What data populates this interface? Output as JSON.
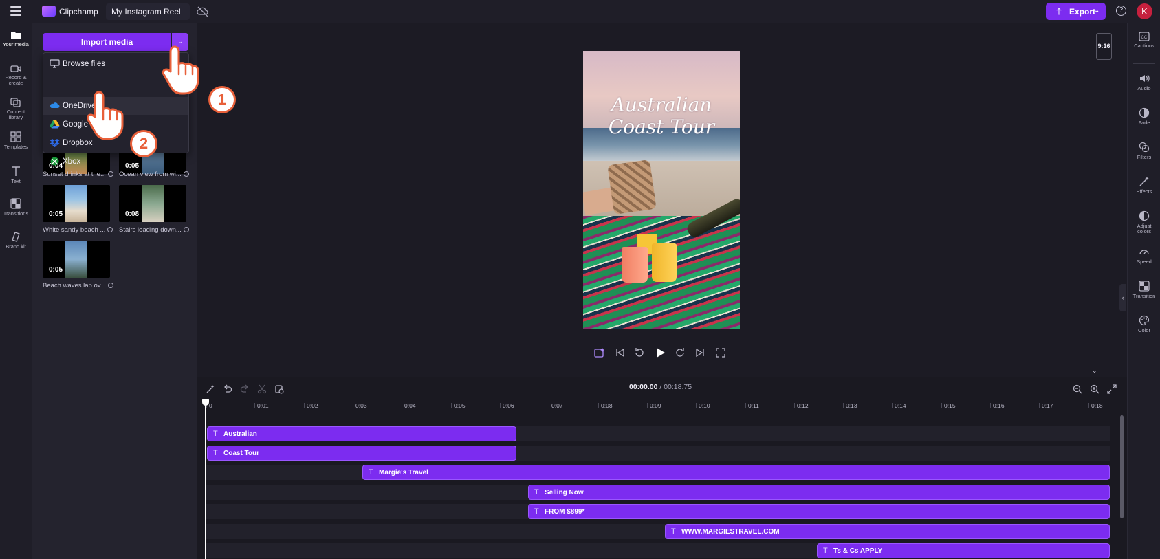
{
  "topbar": {
    "app_name": "Clipchamp",
    "project_name": "My Instagram Reel",
    "export_label": "Export",
    "help_label": "?",
    "avatar_initial": "K"
  },
  "left_rail": {
    "items": [
      {
        "label": "Your media"
      },
      {
        "label": "Record &"
      },
      {
        "label": "create"
      },
      {
        "label": "Content"
      },
      {
        "label": "library"
      },
      {
        "label": "Templates"
      },
      {
        "label": "Text"
      },
      {
        "label": "Transitions"
      },
      {
        "label": "Brand kit"
      }
    ]
  },
  "media_panel": {
    "import_label": "Import media",
    "dropdown": {
      "items": [
        {
          "label": "Browse files",
          "icon": "monitor-icon"
        },
        {
          "label": "OneDrive",
          "icon": "onedrive-icon"
        },
        {
          "label": "Google Drive",
          "icon": "google-drive-icon"
        },
        {
          "label": "Dropbox",
          "icon": "dropbox-icon"
        },
        {
          "label": "Xbox",
          "icon": "xbox-icon"
        }
      ]
    },
    "media": [
      {
        "duration": "0:04",
        "label": "Sunset drinks at the..."
      },
      {
        "duration": "0:05",
        "label": "Ocean view from wi..."
      },
      {
        "duration": "0:05",
        "label": "White sandy beach ..."
      },
      {
        "duration": "0:08",
        "label": "Stairs leading down..."
      },
      {
        "duration": "0:05",
        "label": "Beach waves lap ov..."
      }
    ]
  },
  "preview": {
    "title_line1": "Australian",
    "title_line2": "Coast Tour",
    "aspect_ratio": "9:16"
  },
  "right_rail": {
    "items": [
      {
        "label": "Captions"
      },
      {
        "label": "Audio"
      },
      {
        "label": "Fade"
      },
      {
        "label": "Filters"
      },
      {
        "label": "Effects"
      },
      {
        "label": "Adjust"
      },
      {
        "label": "colors"
      },
      {
        "label": "Speed"
      },
      {
        "label": "Transition"
      },
      {
        "label": "Color"
      }
    ]
  },
  "timeline": {
    "current_time": "00:00.00",
    "total_time": "/ 00:18.75",
    "ruler": [
      "0",
      "0:01",
      "0:02",
      "0:03",
      "0:04",
      "0:05",
      "0:06",
      "0:07",
      "0:08",
      "0:09",
      "0:10",
      "0:11",
      "0:12",
      "0:13",
      "0:14",
      "0:15",
      "0:16",
      "0:17",
      "0:18"
    ],
    "clips": [
      {
        "label": "Australian"
      },
      {
        "label": "Coast Tour"
      },
      {
        "label": "Margie's Travel"
      },
      {
        "label": "Selling Now"
      },
      {
        "label": "FROM $899*"
      },
      {
        "label": "WWW.MARGIESTRAVEL.COM"
      },
      {
        "label": "Ts & Cs APPLY"
      }
    ]
  },
  "annotations": {
    "step1": "1",
    "step2": "2"
  },
  "colors": {
    "accent": "#7c2cf0",
    "badge": "#e8603a",
    "avatar": "#c6203e"
  }
}
